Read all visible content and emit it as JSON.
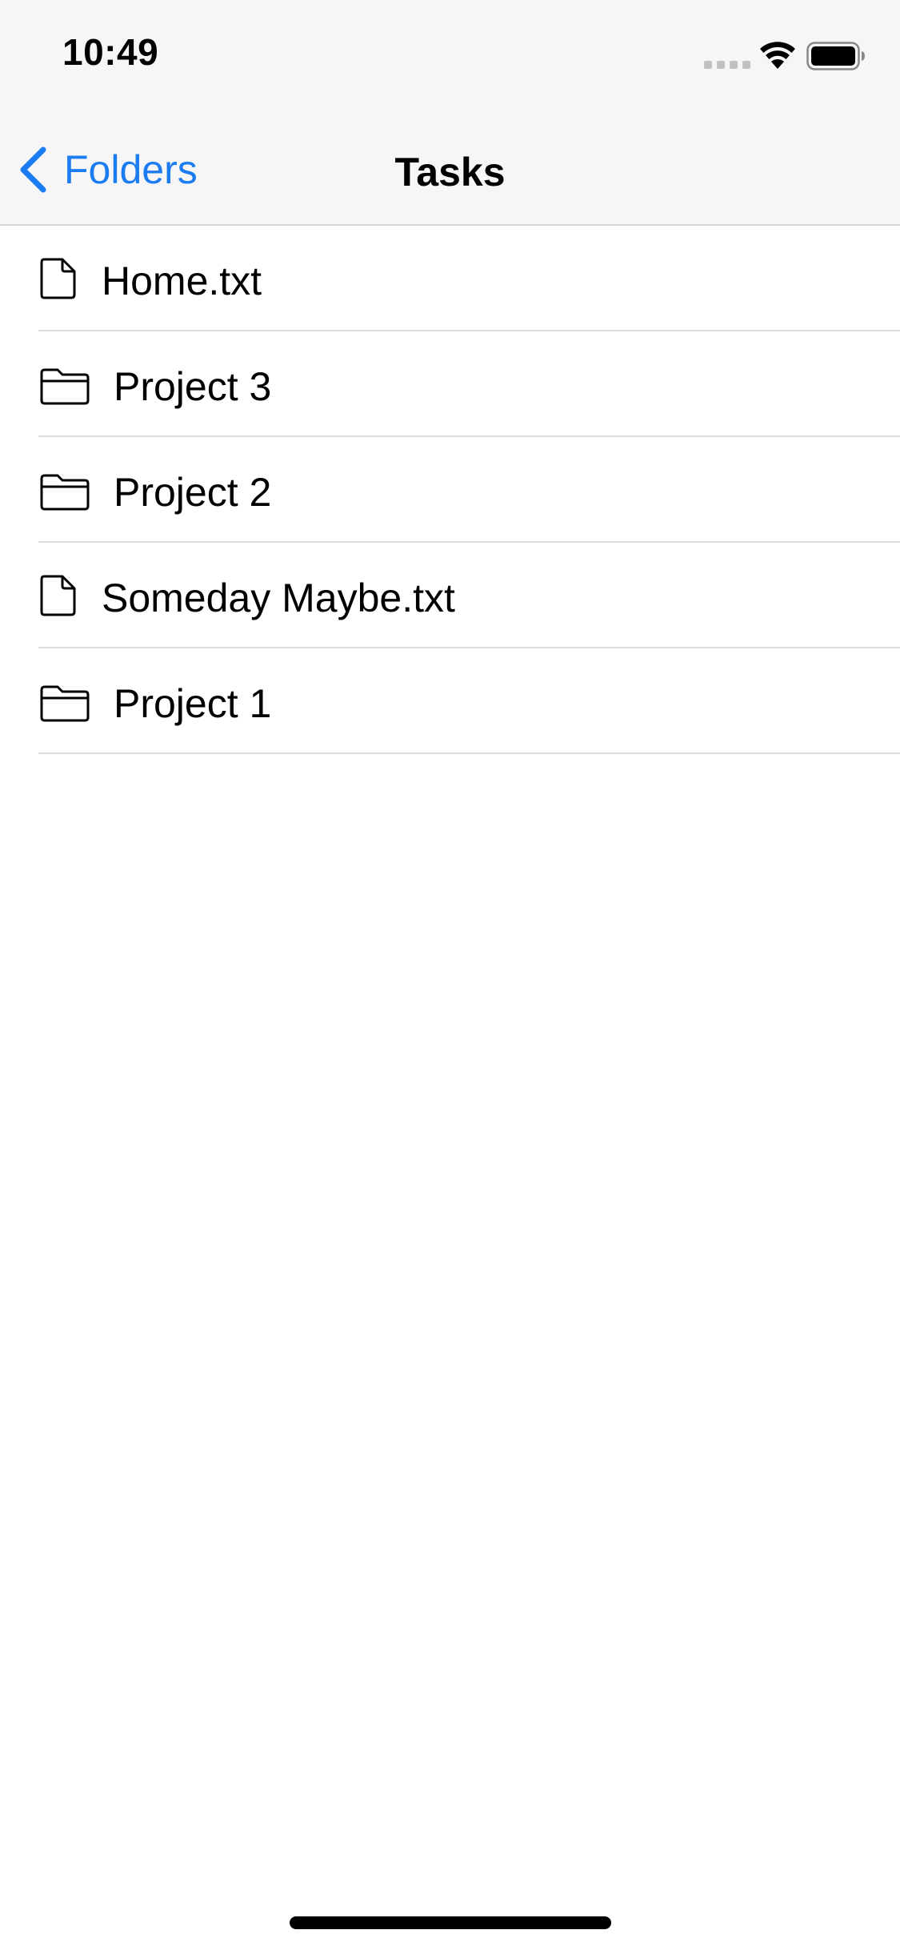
{
  "status_bar": {
    "time": "10:49",
    "icons": [
      "signal-dots-icon",
      "wifi-icon",
      "battery-icon"
    ]
  },
  "nav": {
    "back_label": "Folders",
    "title": "Tasks",
    "accent_color": "#1a7cf0"
  },
  "items": [
    {
      "type": "file",
      "icon": "file-icon",
      "label": "Home.txt"
    },
    {
      "type": "folder",
      "icon": "folder-icon",
      "label": "Project 3"
    },
    {
      "type": "folder",
      "icon": "folder-icon",
      "label": "Project 2"
    },
    {
      "type": "file",
      "icon": "file-icon",
      "label": "Someday Maybe.txt"
    },
    {
      "type": "folder",
      "icon": "folder-icon",
      "label": "Project 1"
    }
  ]
}
